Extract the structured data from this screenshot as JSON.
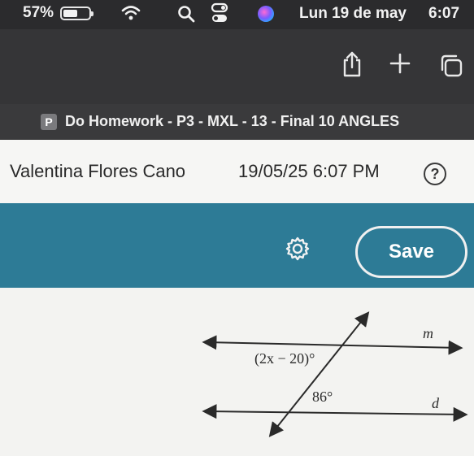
{
  "status_bar": {
    "battery_percent": "57%",
    "battery_level": 0.57,
    "date": "Lun 19 de may",
    "time": "6:07",
    "icons": [
      "battery-icon",
      "wifi-icon",
      "search-icon",
      "control-center-icon",
      "siri-icon"
    ]
  },
  "toolbar": {
    "icons": [
      "share-icon",
      "plus-icon",
      "tabs-icon"
    ]
  },
  "tab": {
    "favicon_letter": "P",
    "title": "Do Homework - P3 - MXL - 13 - Final 10 ANGLES"
  },
  "header": {
    "student_name": "Valentina Flores Cano",
    "datetime": "19/05/25 6:07 PM",
    "help_label": "?"
  },
  "actions": {
    "settings_icon": "gear-icon",
    "save_label": "Save",
    "accent_color": "#2d7b96"
  },
  "problem": {
    "line_top_label": "m",
    "line_bottom_label": "d",
    "angle_top": "(2x − 20)°",
    "angle_bottom": "86°"
  }
}
